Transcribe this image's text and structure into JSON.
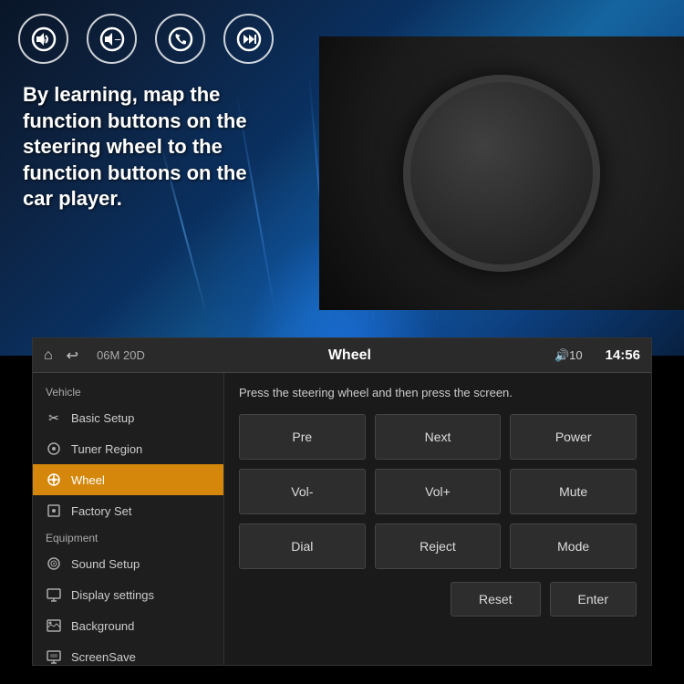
{
  "hero": {
    "text": "By learning, map the function buttons on the steering wheel to the function buttons on the car player.",
    "icons": [
      {
        "name": "vol-up-icon",
        "symbol": "🔊+"
      },
      {
        "name": "vol-down-icon",
        "symbol": "🔉-"
      },
      {
        "name": "phone-icon",
        "symbol": "📞"
      },
      {
        "name": "skip-icon",
        "symbol": "⏭"
      }
    ]
  },
  "header": {
    "home_icon": "⌂",
    "back_icon": "↩",
    "date": "06M 20D",
    "title": "Wheel",
    "vol": "🔊10",
    "time": "14:56"
  },
  "sidebar": {
    "section1_label": "Vehicle",
    "section2_label": "Equipment",
    "items": [
      {
        "id": "basic-setup",
        "icon": "✂",
        "label": "Basic Setup",
        "active": false
      },
      {
        "id": "tuner-region",
        "icon": "📻",
        "label": "Tuner Region",
        "active": false
      },
      {
        "id": "wheel",
        "icon": "⊙",
        "label": "Wheel",
        "active": true
      },
      {
        "id": "factory-set",
        "icon": "📷",
        "label": "Factory Set",
        "active": false
      },
      {
        "id": "sound-setup",
        "icon": "🎵",
        "label": "Sound Setup",
        "active": false
      },
      {
        "id": "display-settings",
        "icon": "🖥",
        "label": "Display settings",
        "active": false
      },
      {
        "id": "background",
        "icon": "🖼",
        "label": "Background",
        "active": false
      },
      {
        "id": "screensave",
        "icon": "💻",
        "label": "ScreenSave",
        "active": false
      }
    ]
  },
  "content": {
    "instruction": "Press the steering wheel and then press the screen.",
    "buttons": [
      {
        "id": "pre",
        "label": "Pre"
      },
      {
        "id": "next",
        "label": "Next"
      },
      {
        "id": "power",
        "label": "Power"
      },
      {
        "id": "vol-minus",
        "label": "Vol-"
      },
      {
        "id": "vol-plus",
        "label": "Vol+"
      },
      {
        "id": "mute",
        "label": "Mute"
      },
      {
        "id": "dial",
        "label": "Dial"
      },
      {
        "id": "reject",
        "label": "Reject"
      },
      {
        "id": "mode",
        "label": "Mode"
      }
    ],
    "action_buttons": [
      {
        "id": "reset",
        "label": "Reset"
      },
      {
        "id": "enter",
        "label": "Enter"
      }
    ]
  },
  "colors": {
    "active_bg": "#d4870a",
    "panel_bg": "#1a1a1a",
    "btn_bg": "#2d2d2d"
  }
}
